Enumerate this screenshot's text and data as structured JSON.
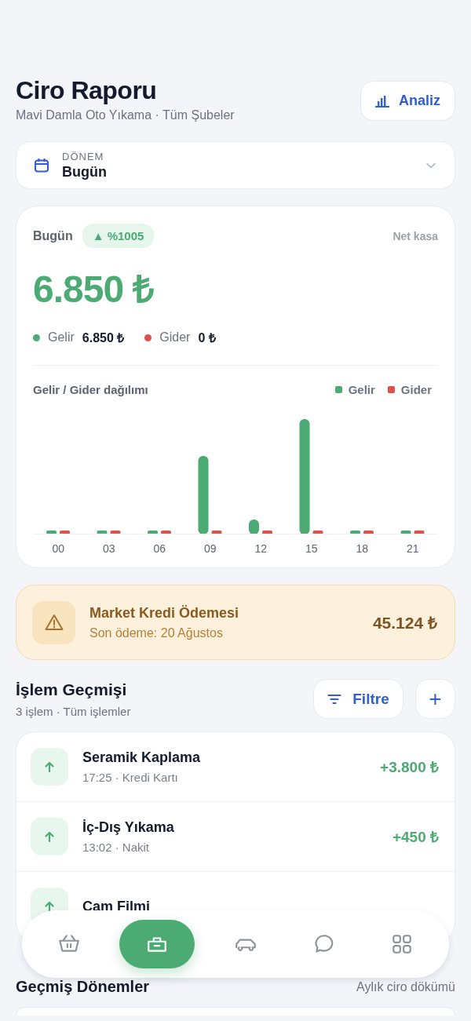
{
  "header": {
    "title": "Ciro Raporu",
    "subtitle": "Mavi Damla Oto Yıkama · Tüm Şubeler",
    "action": "Analiz"
  },
  "period": {
    "label": "DÖNEM",
    "value": "Bugün"
  },
  "summary": {
    "period": "Bugün",
    "change": "▲ %1005",
    "caption": "Net kasa",
    "total": "6.850 ₺",
    "totals": [
      {
        "label": "Gelir",
        "value": "6.850 ₺",
        "color": "#4caa73"
      },
      {
        "label": "Gider",
        "value": "0 ₺",
        "color": "#dc5149"
      }
    ],
    "chart": {
      "title": "Gelir / Gider dağılımı",
      "legend": [
        {
          "label": "Gelir",
          "color": "#4caa73"
        },
        {
          "label": "Gider",
          "color": "#dc5149"
        }
      ],
      "x_labels": [
        "00",
        "03",
        "06",
        "09",
        "12",
        "15",
        "18",
        "21"
      ]
    }
  },
  "alert": {
    "title": "Market Kredi Ödemesi",
    "detail": "Son ödeme: 20 Ağustos",
    "amount": "45.124 ₺"
  },
  "transactions": {
    "title": "İşlem Geçmişi",
    "subtitle": "3 işlem · Tüm işlemler",
    "filter": "Filtre",
    "add": "+",
    "items": [
      {
        "kind": "income",
        "name": "Seramik Kaplama",
        "detail": "17:25 · Kredi Kartı",
        "amount": "+3.800 ₺"
      },
      {
        "kind": "income",
        "name": "İç-Dış Yıkama",
        "detail": "13:02 · Nakit",
        "amount": "+450 ₺"
      },
      {
        "kind": "income",
        "name": "Cam Filmi"
      }
    ]
  },
  "history": {
    "title": "Geçmiş Dönemler",
    "caption": "Aylık ciro dökümü"
  },
  "nav": [
    {
      "selected": false
    },
    {
      "selected": true
    },
    {
      "selected": false
    },
    {
      "selected": false
    },
    {
      "selected": false
    }
  ]
}
